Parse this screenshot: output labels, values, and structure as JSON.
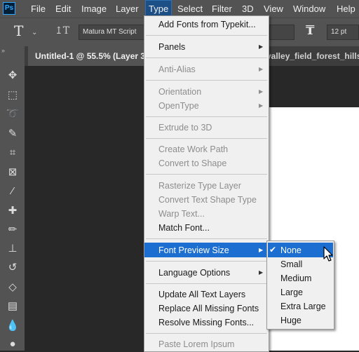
{
  "menubar": {
    "logo": "Ps",
    "items": [
      "File",
      "Edit",
      "Image",
      "Layer",
      "Type",
      "Select",
      "Filter",
      "3D",
      "View",
      "Window",
      "Help"
    ]
  },
  "options": {
    "tool_icon": "type-tool-icon",
    "font_family": "Matura MT Script",
    "font_size": "12 pt"
  },
  "tabs": {
    "active": "Untitled-1 @ 55.5% (Layer 3,",
    "other": "valley_field_forest_hills"
  },
  "type_menu": {
    "add_fonts": "Add Fonts from Typekit...",
    "panels": "Panels",
    "anti_alias": "Anti-Alias",
    "orientation": "Orientation",
    "opentype": "OpenType",
    "extrude": "Extrude to 3D",
    "create_work_path": "Create Work Path",
    "convert_to_shape": "Convert to Shape",
    "rasterize": "Rasterize Type Layer",
    "convert_text_shape": "Convert Text Shape Type",
    "warp_text": "Warp Text...",
    "match_font": "Match Font...",
    "font_preview_size": "Font Preview Size",
    "language_options": "Language Options",
    "update_all": "Update All Text Layers",
    "replace_missing": "Replace All Missing Fonts",
    "resolve_missing": "Resolve Missing Fonts...",
    "paste_lorem": "Paste Lorem Ipsum"
  },
  "submenu": {
    "checked": "✔",
    "items": [
      "None",
      "Small",
      "Medium",
      "Large",
      "Extra Large",
      "Huge"
    ]
  },
  "colors": {
    "menu_highlight": "#1c6fd0",
    "panel_bg": "#535353",
    "workspace_bg": "#282828"
  }
}
